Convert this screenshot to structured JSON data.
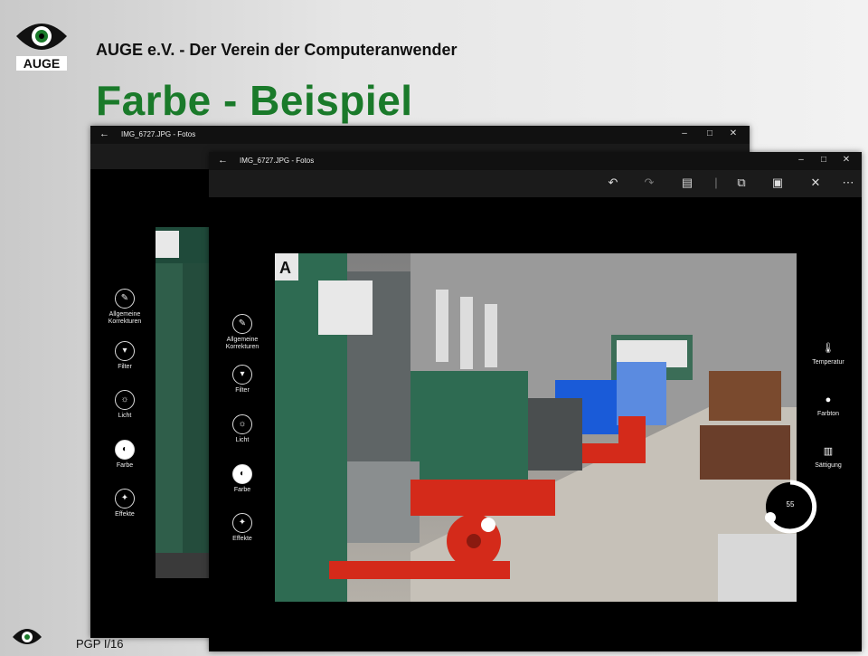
{
  "slide": {
    "org": "AUGE e.V. - Der Verein der Computeranwender",
    "title": "Farbe - Beispiel",
    "logo_text": "AUGE",
    "footer": "PGP I/16"
  },
  "window_back": {
    "title": "IMG_6727.JPG - Fotos",
    "tools": [
      {
        "label": "Allgemeine Korrekturen",
        "icon": "wrench-icon"
      },
      {
        "label": "Filter",
        "icon": "filter-icon"
      },
      {
        "label": "Licht",
        "icon": "sun-icon"
      },
      {
        "label": "Farbe",
        "icon": "palette-icon"
      },
      {
        "label": "Effekte",
        "icon": "effects-icon"
      }
    ]
  },
  "window_front": {
    "title": "IMG_6727.JPG - Fotos",
    "tools": [
      {
        "label": "Allgemeine Korrekturen",
        "icon": "wrench-icon"
      },
      {
        "label": "Filter",
        "icon": "filter-icon"
      },
      {
        "label": "Licht",
        "icon": "sun-icon"
      },
      {
        "label": "Farbe",
        "icon": "palette-icon"
      },
      {
        "label": "Effekte",
        "icon": "effects-icon"
      }
    ],
    "right_tools": [
      {
        "label": "Temperatur",
        "icon": "thermometer-icon"
      },
      {
        "label": "Farbton",
        "icon": "tint-icon"
      },
      {
        "label": "Sättigung",
        "icon": "saturation-icon"
      }
    ],
    "dial_value": "55",
    "photo_sign": "A"
  },
  "colors": {
    "title_green": "#1a7a2a",
    "locomotive_green": "#2e6b52",
    "locomotive_red": "#d42a1a",
    "blue_machine": "#1a5bd8"
  }
}
